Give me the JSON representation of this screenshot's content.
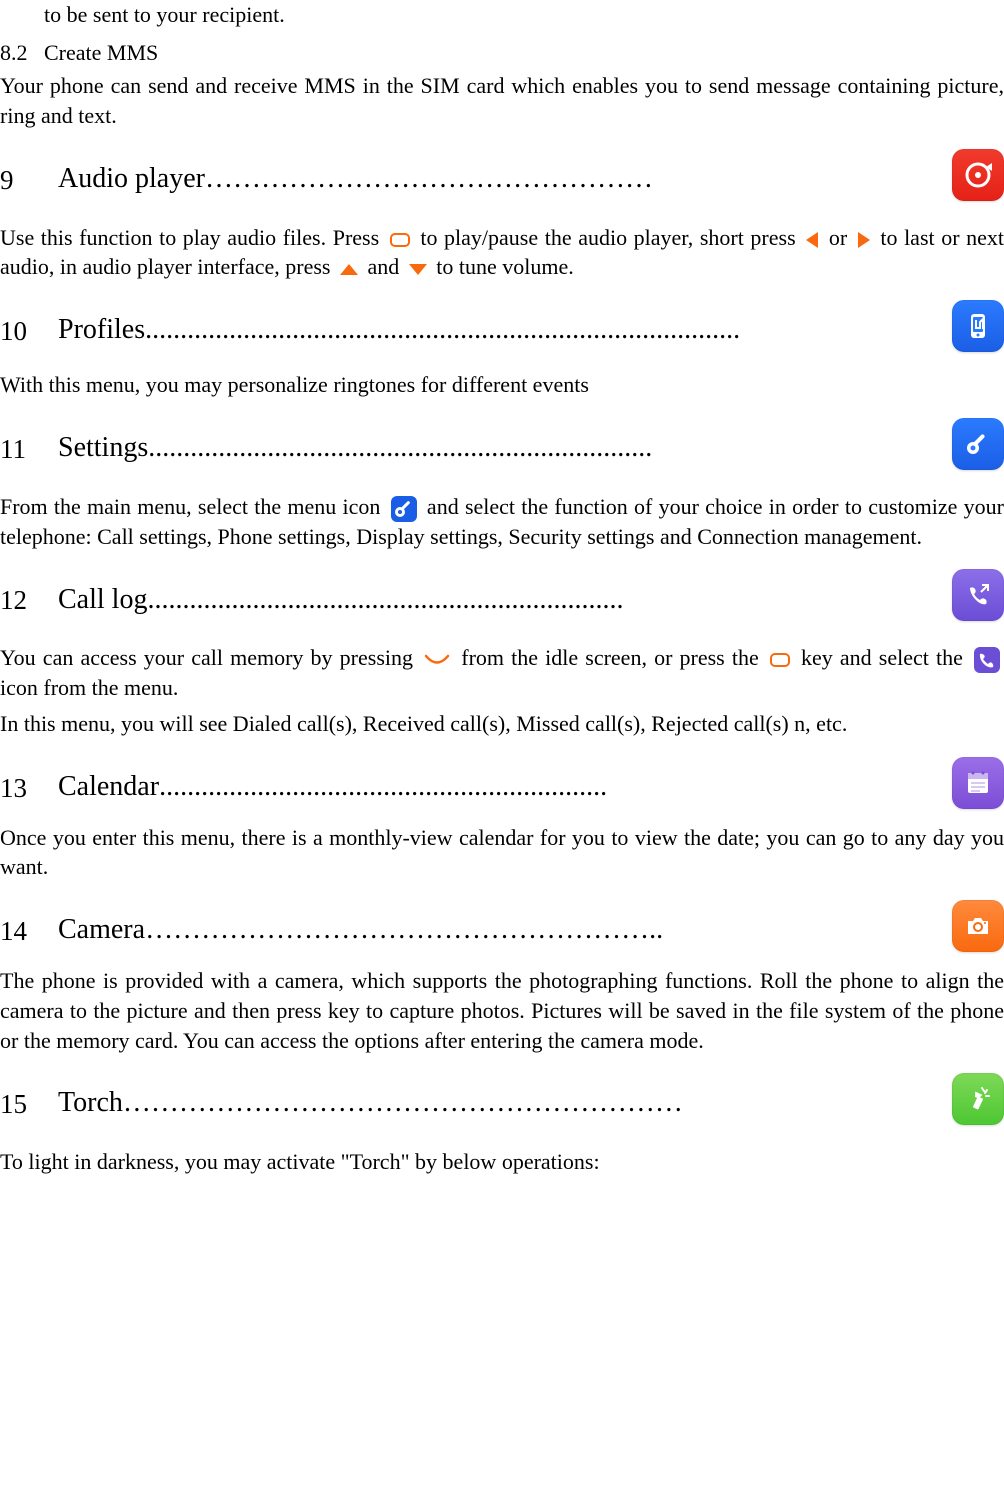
{
  "top_line": "to be sent to your recipient.",
  "sub82": {
    "num": "8.2",
    "title": "Create MMS"
  },
  "mms_body": "Your phone can send and receive MMS in the SIM card which enables you to send message containing picture, ring and text.",
  "s9": {
    "num": "9",
    "title": "Audio player",
    "dots": "…………………………………………"
  },
  "audio_body": {
    "p1a": "Use this function to play audio files. Press ",
    "p1b": " to play/pause the audio player, short press ",
    "p1c": " or ",
    "p1d": " to last or next audio, in audio player interface, press ",
    "p1e": " and ",
    "p1f": " to tune volume."
  },
  "s10": {
    "num": "10",
    "title": "Profiles",
    "dots": "....................................................................................."
  },
  "profiles_body": "With this menu, you may personalize ringtones for different events",
  "s11": {
    "num": "11",
    "title": "Settings",
    "dots": "........................................................................"
  },
  "settings_body": {
    "a": "From the main menu, select the menu icon ",
    "b": " and select the function of your choice in order to customize your telephone: Call settings, Phone settings, Display settings, Security settings and Connection management."
  },
  "s12": {
    "num": "12",
    "title": "Call log",
    "dots": "...................................................................."
  },
  "calllog_body": {
    "a": "You can access your call memory by pressing ",
    "b": " from the idle screen, or press the ",
    "c": " key and select the ",
    "d": " icon from the menu.",
    "e": "In this menu, you will see Dialed call(s), Received call(s), Missed call(s), Rejected call(s) n, etc."
  },
  "s13": {
    "num": "13",
    "title": "Calendar",
    "dots": "................................................................"
  },
  "calendar_body": "Once you enter this menu, there is a monthly-view calendar for you to view the date; you can go to any day you want.",
  "s14": {
    "num": "14",
    "title": "Camera",
    "dots": "……………………………………………….."
  },
  "camera_body": "The phone is provided with a camera, which supports the photographing functions. Roll the phone to align the camera to the picture and then press   key to capture photos. Pictures will be saved in the file system of the phone or the memory card. You can access the options after entering the camera mode.",
  "s15": {
    "num": "15",
    "title": "Torch",
    "dots": "……………………………………………………"
  },
  "torch_body": "To light in darkness, you may activate \"Torch\" by below operations:"
}
